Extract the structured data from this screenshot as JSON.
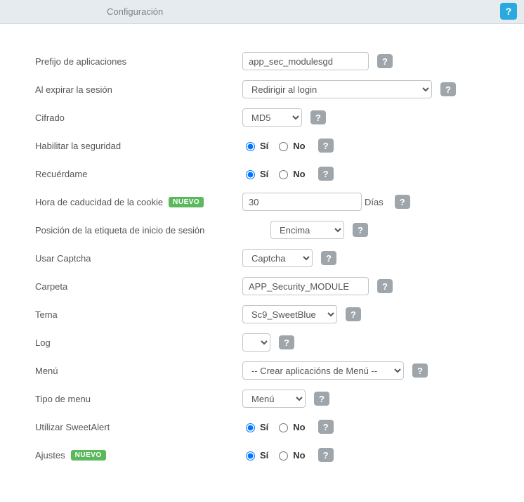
{
  "header": {
    "title": "Configuración",
    "help": "?"
  },
  "badge_new": "NUEVO",
  "radio": {
    "yes": "Sí",
    "no": "No"
  },
  "rows": {
    "prefix": {
      "label": "Prefijo de aplicaciones",
      "value": "app_sec_modulesgd"
    },
    "expire": {
      "label": "Al expirar la sesión",
      "value": "Redirigir al login"
    },
    "cipher": {
      "label": "Cifrado",
      "value": "MD5"
    },
    "secenable": {
      "label": "Habilitar la seguridad"
    },
    "remember": {
      "label": "Recuérdame"
    },
    "cookie": {
      "label": "Hora de caducidad de la cookie",
      "value": "30",
      "unit": "Días"
    },
    "labelpos": {
      "label": "Posición de la etiqueta de inicio de sesión",
      "value": "Encima"
    },
    "captcha": {
      "label": "Usar Captcha",
      "value": "Captcha"
    },
    "folder": {
      "label": "Carpeta",
      "value": "APP_Security_MODULE"
    },
    "theme": {
      "label": "Tema",
      "value": "Sc9_SweetBlue"
    },
    "log": {
      "label": "Log",
      "value": ""
    },
    "menu": {
      "label": "Menú",
      "value": "-- Crear aplicacións de Menú --"
    },
    "menutype": {
      "label": "Tipo de menu",
      "value": "Menú"
    },
    "sweetalert": {
      "label": "Utilizar SweetAlert"
    },
    "settings": {
      "label": "Ajustes"
    }
  }
}
